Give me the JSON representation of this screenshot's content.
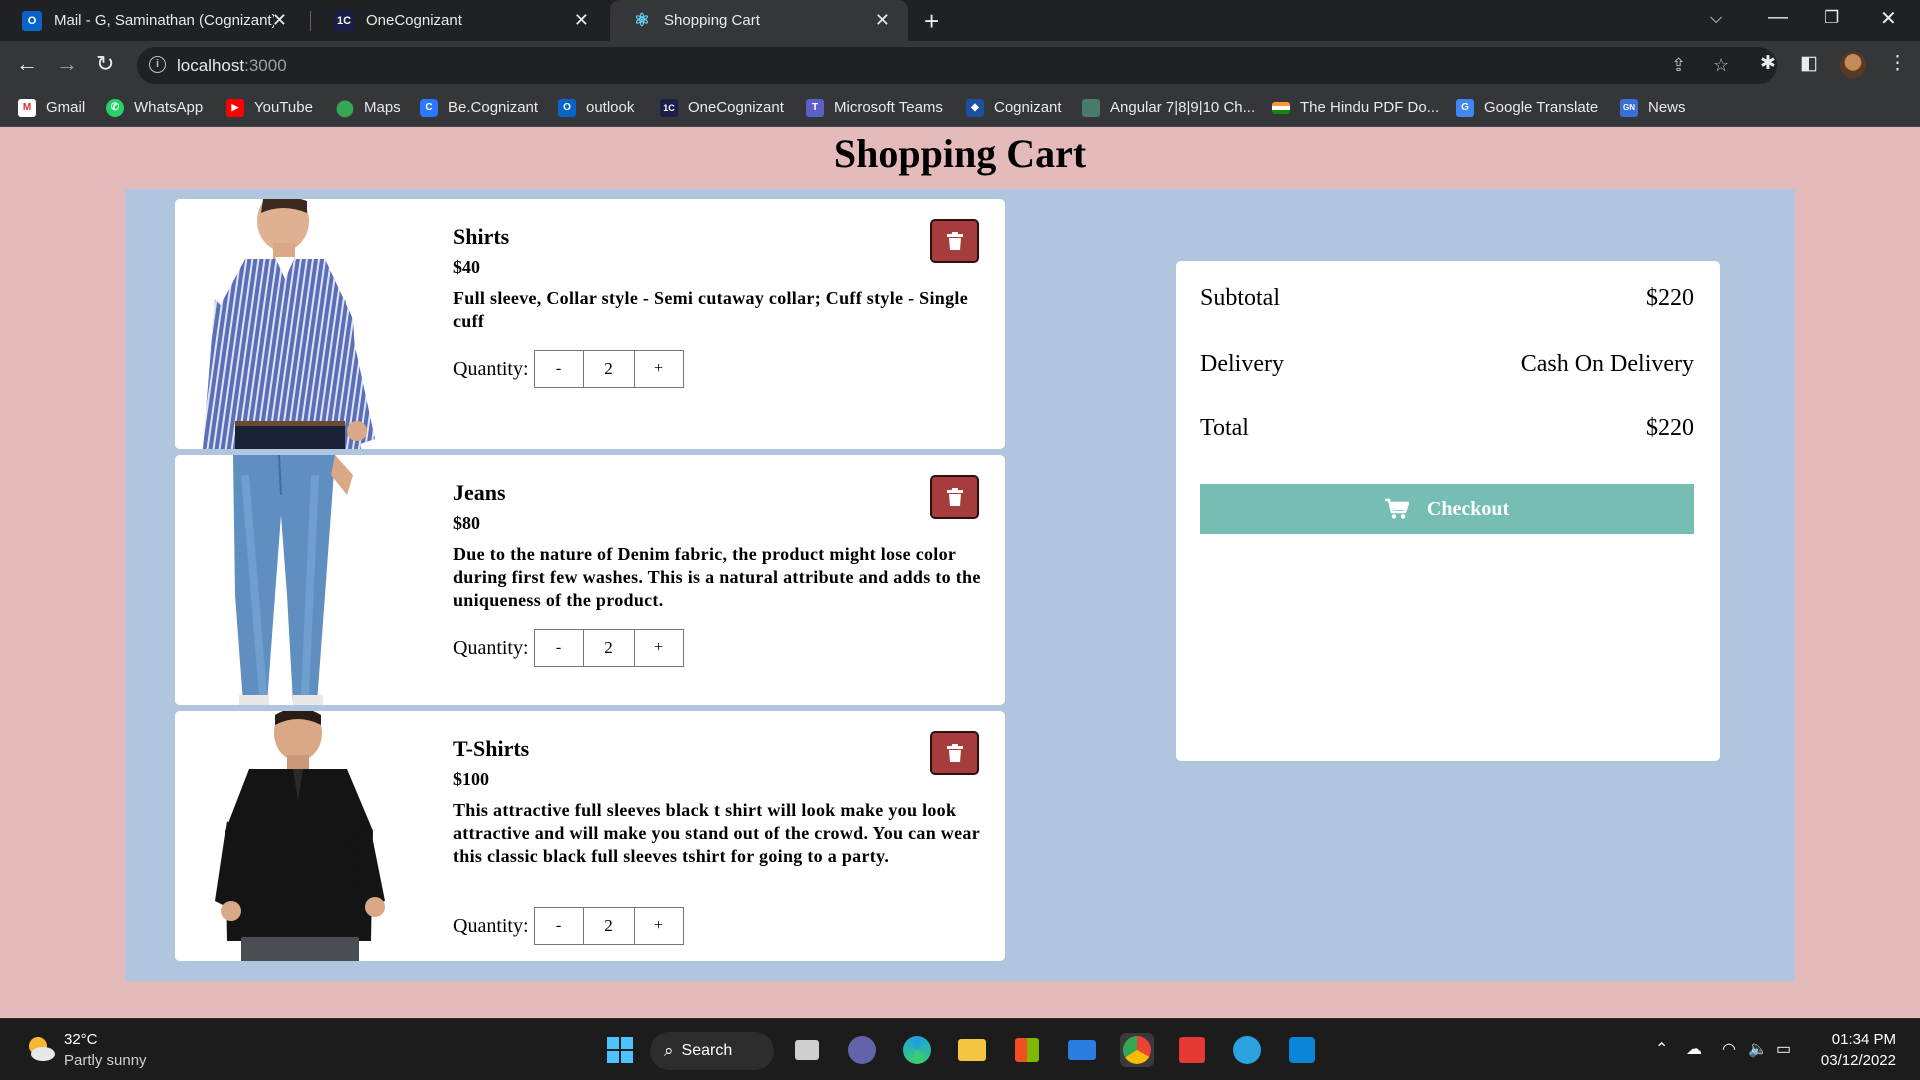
{
  "browser": {
    "tabs": [
      {
        "title": "Mail - G, Saminathan (Cognizant)",
        "icon": "outlook-icon",
        "active": false
      },
      {
        "title": "OneCognizant",
        "icon": "onecognizant-icon",
        "active": false
      },
      {
        "title": "Shopping Cart",
        "icon": "react-icon",
        "active": true
      }
    ],
    "url_host": "localhost",
    "url_port": ":3000",
    "bookmarks": [
      {
        "label": "Gmail",
        "icon": "gmail-icon"
      },
      {
        "label": "WhatsApp",
        "icon": "whatsapp-icon"
      },
      {
        "label": "YouTube",
        "icon": "youtube-icon"
      },
      {
        "label": "Maps",
        "icon": "maps-icon"
      },
      {
        "label": "Be.Cognizant",
        "icon": "becognizant-icon"
      },
      {
        "label": "outlook",
        "icon": "outlook-icon"
      },
      {
        "label": "OneCognizant",
        "icon": "onecognizant-icon"
      },
      {
        "label": "Microsoft Teams",
        "icon": "teams-icon"
      },
      {
        "label": "Cognizant",
        "icon": "cognizant-icon"
      },
      {
        "label": "Angular 7|8|9|10 Ch...",
        "icon": "page-icon"
      },
      {
        "label": "The Hindu PDF Do...",
        "icon": "india-flag-icon"
      },
      {
        "label": "Google Translate",
        "icon": "translate-icon"
      },
      {
        "label": "News",
        "icon": "news-icon"
      }
    ]
  },
  "page": {
    "title": "Shopping Cart",
    "items": [
      {
        "name": "Shirts",
        "price": "$40",
        "description": "Full sleeve, Collar style - Semi cutaway collar; Cuff style - Single cuff",
        "quantity_label": "Quantity:",
        "quantity": "2",
        "minus": "-",
        "plus": "+"
      },
      {
        "name": "Jeans",
        "price": "$80",
        "description": "Due to the nature of Denim fabric, the product might lose color during first few washes. This is a natural attribute and adds to the uniqueness of the product.",
        "quantity_label": "Quantity:",
        "quantity": "2",
        "minus": "-",
        "plus": "+"
      },
      {
        "name": "T-Shirts",
        "price": "$100",
        "description": "This attractive full sleeves black t shirt will look make you look attractive and will make you stand out of the crowd. You can wear this classic black full sleeves tshirt for going to a party.",
        "quantity_label": "Quantity:",
        "quantity": "2",
        "minus": "-",
        "plus": "+"
      }
    ],
    "summary": {
      "subtotal_label": "Subtotal",
      "subtotal_value": "$220",
      "delivery_label": "Delivery",
      "delivery_value": "Cash On Delivery",
      "total_label": "Total",
      "total_value": "$220",
      "checkout_label": "Checkout"
    },
    "colors": {
      "page_background": "#e4bbba",
      "panel_background": "#b0c6de",
      "delete_button": "#a63c3c",
      "checkout_button": "#76bdb4"
    }
  },
  "taskbar": {
    "temperature": "32°C",
    "condition": "Partly sunny",
    "search_label": "Search",
    "time": "01:34 PM",
    "date": "03/12/2022"
  }
}
